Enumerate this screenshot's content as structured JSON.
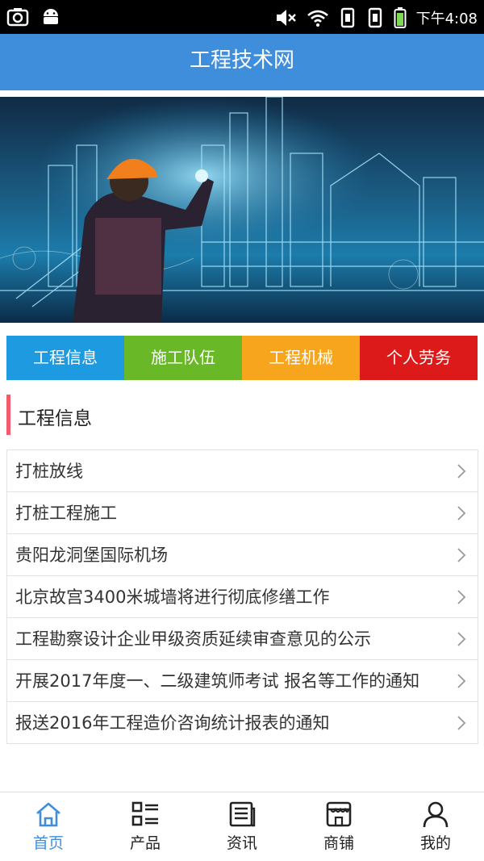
{
  "status_bar": {
    "time": "下午4:08"
  },
  "header": {
    "title": "工程技术网"
  },
  "categories": [
    {
      "label": "工程信息",
      "color": "#1d9ae0"
    },
    {
      "label": "施工队伍",
      "color": "#69b827"
    },
    {
      "label": "工程机械",
      "color": "#f7a51c"
    },
    {
      "label": "个人劳务",
      "color": "#dd1a1a"
    }
  ],
  "section": {
    "title": "工程信息",
    "accent": "#f15b6c"
  },
  "list": [
    "打桩放线",
    "打桩工程施工",
    "贵阳龙洞堡国际机场",
    "北京故宫3400米城墙将进行彻底修缮工作",
    "工程勘察设计企业甲级资质延续审查意见的公示",
    "开展2017年度一、二级建筑师考试 报名等工作的通知",
    "报送2016年工程造价咨询统计报表的通知"
  ],
  "bottom_nav": [
    {
      "label": "首页",
      "icon": "home-icon",
      "active": true
    },
    {
      "label": "产品",
      "icon": "grid-list-icon",
      "active": false
    },
    {
      "label": "资讯",
      "icon": "news-icon",
      "active": false
    },
    {
      "label": "商铺",
      "icon": "shop-icon",
      "active": false
    },
    {
      "label": "我的",
      "icon": "user-icon",
      "active": false
    }
  ],
  "colors": {
    "primary": "#3f8edc",
    "active_nav": "#3f8edc"
  }
}
